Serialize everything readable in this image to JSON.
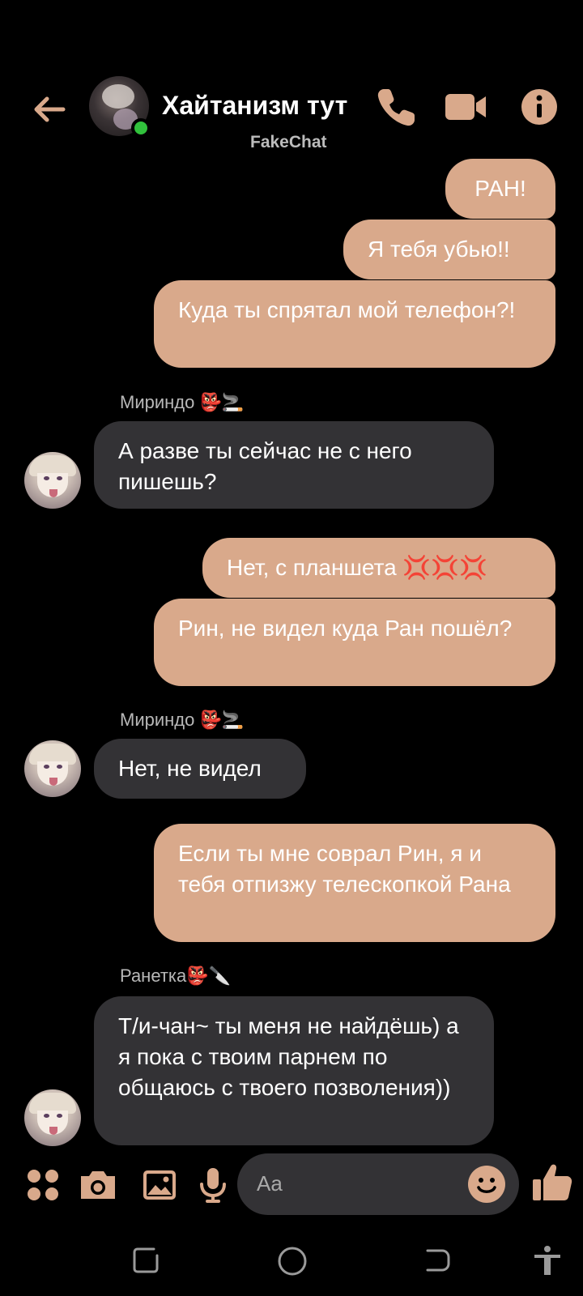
{
  "header": {
    "title": "Хайтанизм тут",
    "subtitle": "FakeChat"
  },
  "colors": {
    "accent": "#d9a98b",
    "incoming_bubble": "#333235",
    "online": "#31c13c"
  },
  "messages": [
    {
      "dir": "out",
      "text": "РАН!"
    },
    {
      "dir": "out",
      "text": "Я тебя убью!!"
    },
    {
      "dir": "out",
      "text": "Куда ты спрятал мой телефон?!"
    },
    {
      "dir": "in",
      "sender": "Мириндо 👺🚬",
      "text": "А разве ты сейчас не с него пишешь?"
    },
    {
      "dir": "out",
      "text": "Нет, с планшета 💢💢💢"
    },
    {
      "dir": "out",
      "text": "Рин, не видел куда Ран пошёл?"
    },
    {
      "dir": "in",
      "sender": "Мириндо 👺🚬",
      "text": "Нет, не видел"
    },
    {
      "dir": "out",
      "text": "Если ты мне соврал Рин, я и тебя отпизжу телескопкой Рана"
    },
    {
      "dir": "in",
      "sender": "Ранетка👺🔪",
      "text": "Т/и-чан~ ты меня не найдёшь) а я пока с твоим парнем по общаюсь с твоего позволения))"
    }
  ],
  "composer": {
    "placeholder": "Aa"
  },
  "icons": {
    "back": "arrow-left-icon",
    "call": "phone-icon",
    "video": "video-camera-icon",
    "info": "info-icon",
    "menu": "four-dots-icon",
    "camera": "camera-icon",
    "gallery": "image-icon",
    "mic": "microphone-icon",
    "emoji": "smiley-icon",
    "like": "thumbs-up-icon"
  }
}
